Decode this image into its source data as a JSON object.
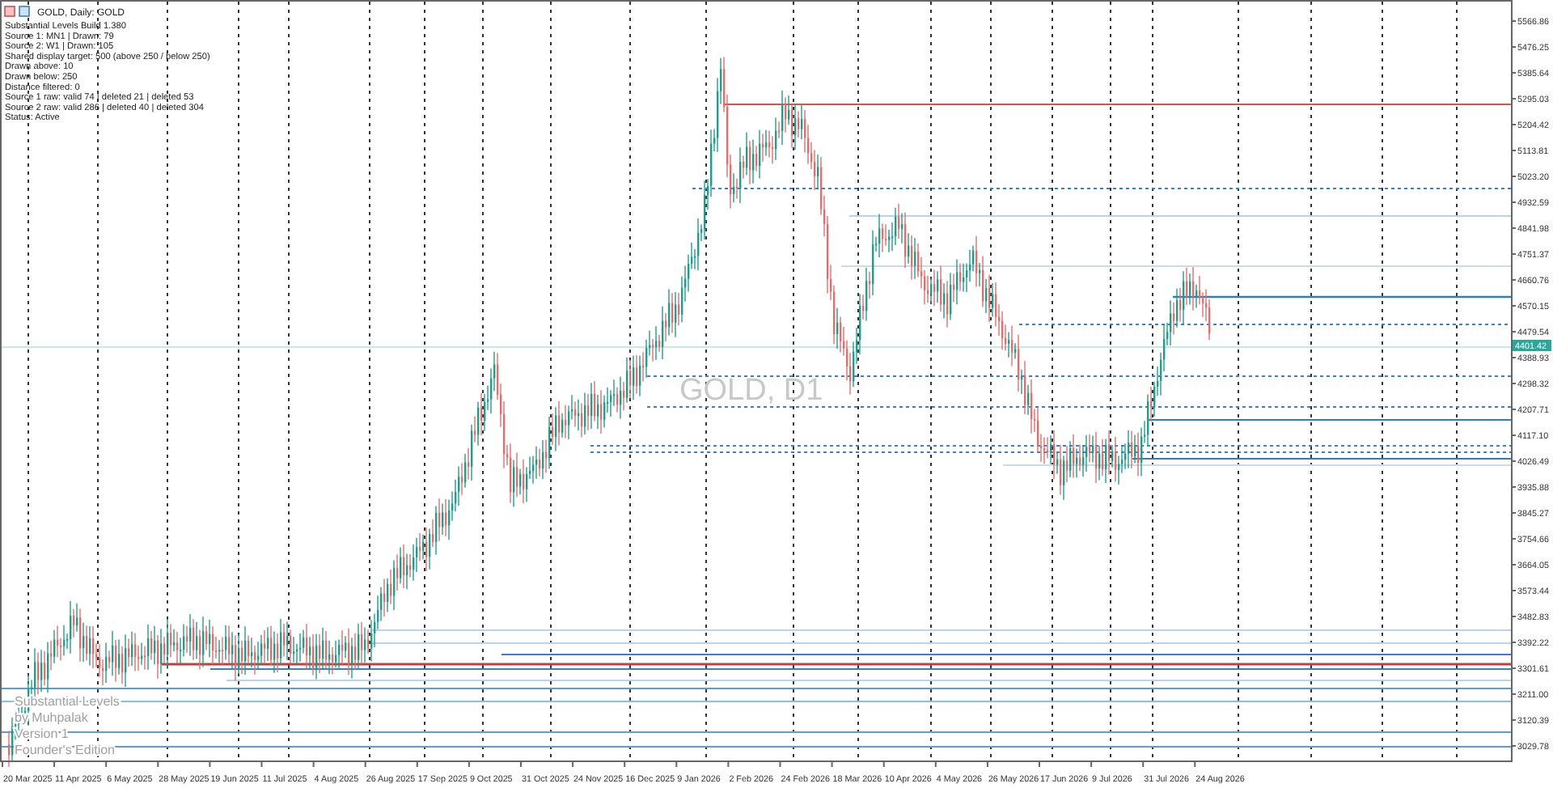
{
  "header": {
    "title": "GOLD, Daily: GOLD"
  },
  "info_lines": [
    "Substantial Levels Build 1.380",
    "Source 1: MN1 | Drawn: 79",
    "Source 2: W1 | Drawn: 105",
    "Shared display target: 500 (above 250 / below 250)",
    "Drawn above: 10",
    "Drawn below: 250",
    "Distance filtered: 0",
    "Source 1 raw: valid 74 | deleted 21 | deleted 53",
    "Source 2 raw: valid 286 | deleted 40 | deleted 304",
    "Status: Active"
  ],
  "watermark": "GOLD, D1",
  "indicator_label": [
    "Substantial Levels",
    "by Muhpalak",
    "Version 1",
    "Founder's Edition"
  ],
  "price_axis": [
    "5566.86",
    "5476.25",
    "5385.64",
    "5295.03",
    "5204.42",
    "5113.81",
    "5023.20",
    "4932.59",
    "4841.98",
    "4751.37",
    "4660.76",
    "4570.15",
    "4479.54",
    "4388.93",
    "4298.32",
    "4207.71",
    "4117.10",
    "4026.49",
    "3935.88",
    "3845.27",
    "3754.66",
    "3664.05",
    "3573.44",
    "3482.83",
    "3392.22",
    "3301.61",
    "3211.00",
    "3120.39",
    "3029.78"
  ],
  "current_price": "4401.42",
  "date_axis": [
    "20 Mar 2025",
    "11 Apr 2025",
    "6 May 2025",
    "28 May 2025",
    "19 Jun 2025",
    "11 Jul 2025",
    "4 Aug 2025",
    "26 Aug 2025",
    "17 Sep 2025",
    "9 Oct 2025",
    "31 Oct 2025",
    "24 Nov 2025",
    "16 Dec 2025",
    "9 Jan 2026",
    "2 Feb 2026",
    "24 Feb 2026",
    "18 Mar 2026",
    "10 Apr 2026",
    "4 May 2026",
    "26 May 2026",
    "17 Jun 2026",
    "9 Jul 2026",
    "31 Jul 2026",
    "24 Aug 2026"
  ]
}
